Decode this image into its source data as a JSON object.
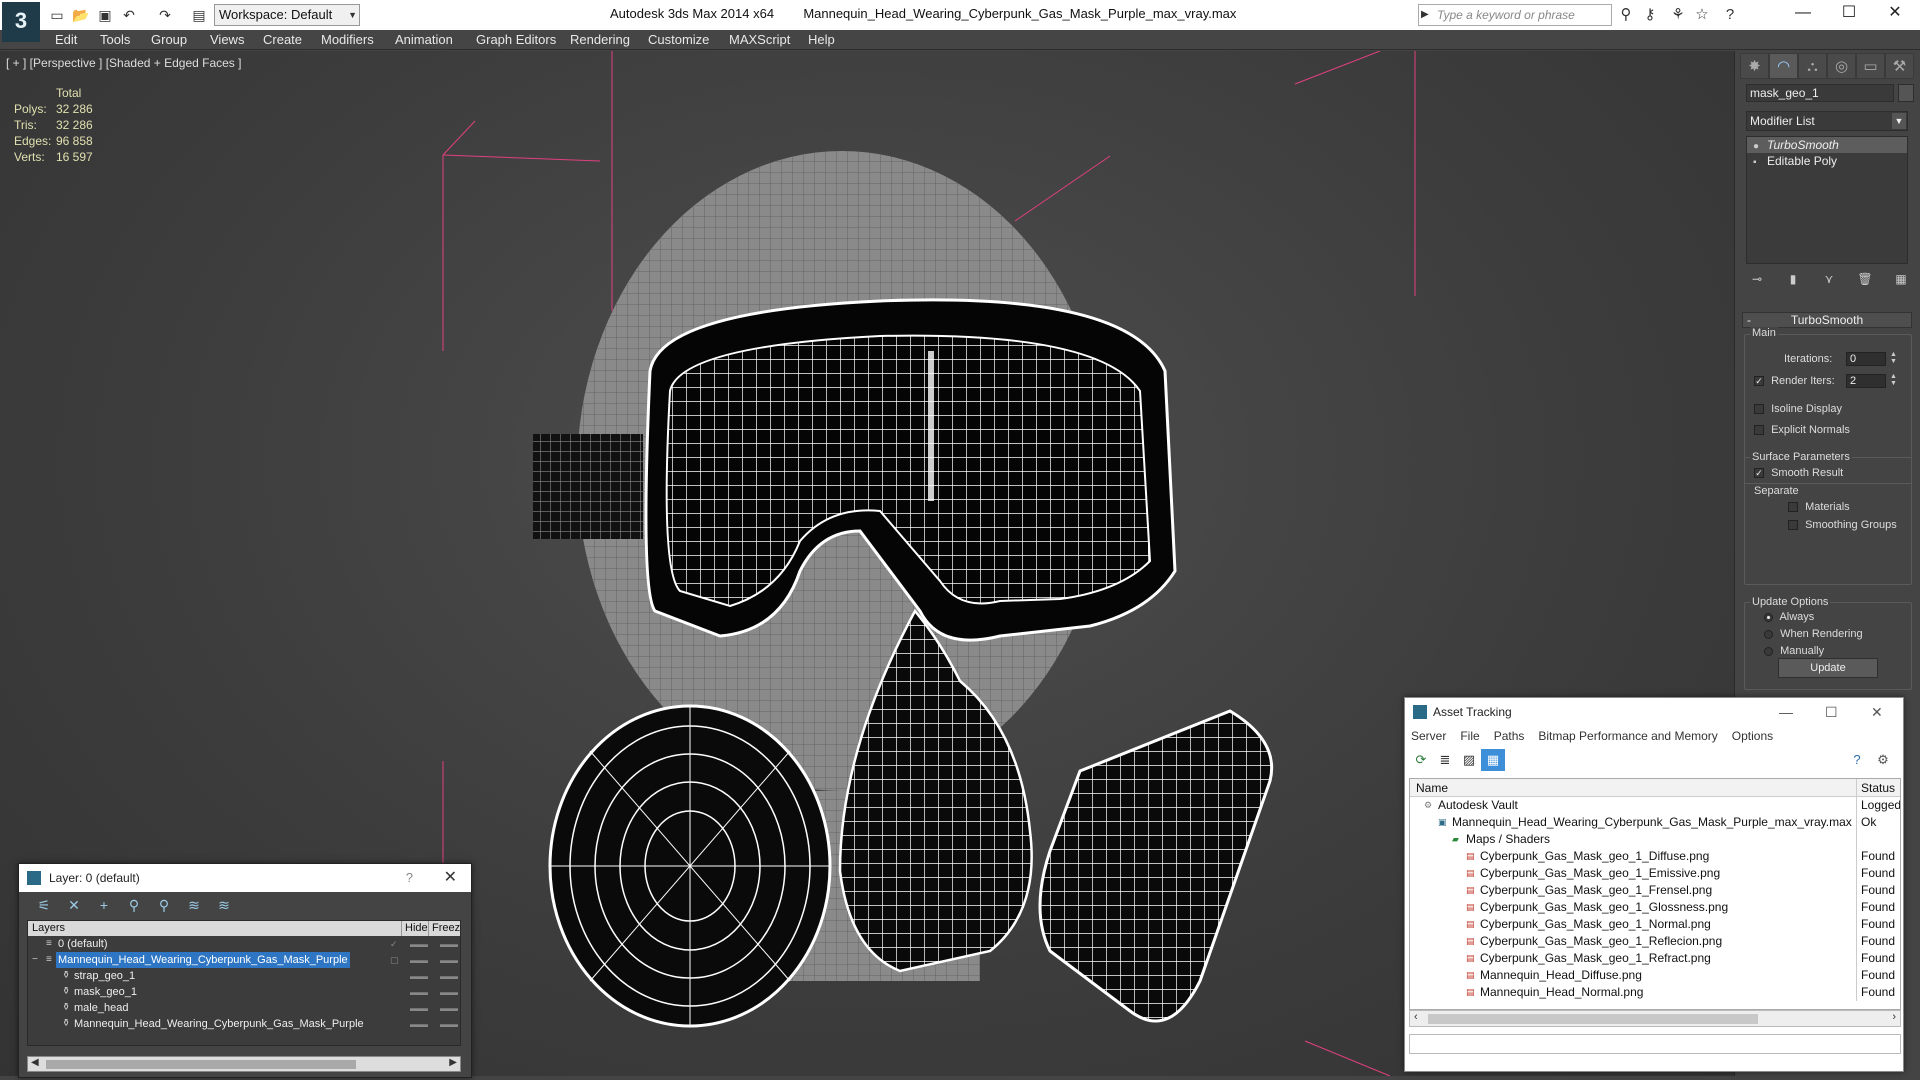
{
  "titlebar": {
    "workspace": "Workspace: Default",
    "app_name": "Autodesk 3ds Max  2014 x64",
    "file_name": "Mannequin_Head_Wearing_Cyberpunk_Gas_Mask_Purple_max_vray.max",
    "search_placeholder": "Type a keyword or phrase"
  },
  "menu": [
    "Edit",
    "Tools",
    "Group",
    "Views",
    "Create",
    "Modifiers",
    "Animation",
    "Graph Editors",
    "Rendering",
    "Customize",
    "MAXScript",
    "Help"
  ],
  "viewport": {
    "label": "[ + ] [Perspective ] [Shaded + Edged Faces ]",
    "stats": {
      "header": "Total",
      "rows": [
        {
          "key": "Polys:",
          "value": "32 286"
        },
        {
          "key": "Tris:",
          "value": "32 286"
        },
        {
          "key": "Edges:",
          "value": "96 858"
        },
        {
          "key": "Verts:",
          "value": "16 597"
        }
      ]
    }
  },
  "command_panel": {
    "object_name": "mask_geo_1",
    "modifier_list": "Modifier List",
    "stack": [
      "TurboSmooth",
      "Editable Poly"
    ],
    "rollout_title": "TurboSmooth",
    "main_label": "Main",
    "iterations_label": "Iterations:",
    "iterations_value": "0",
    "render_iters_label": "Render Iters:",
    "render_iters_value": "2",
    "isoline_display": "Isoline Display",
    "explicit_normals": "Explicit Normals",
    "surface_params": "Surface Parameters",
    "smooth_result": "Smooth Result",
    "separate": "Separate",
    "materials": "Materials",
    "smoothing_groups": "Smoothing Groups",
    "update_options": "Update Options",
    "always": "Always",
    "when_rendering": "When Rendering",
    "manually": "Manually",
    "update_button": "Update"
  },
  "layer_window": {
    "title": "Layer: 0 (default)",
    "help": "?",
    "columns": {
      "layers": "Layers",
      "hide": "Hide",
      "freeze": "Freeze"
    },
    "rows": [
      {
        "name": "0 (default)",
        "indent": 0
      },
      {
        "name": "Mannequin_Head_Wearing_Cyberpunk_Gas_Mask_Purple",
        "indent": 0
      },
      {
        "name": "strap_geo_1",
        "indent": 1
      },
      {
        "name": "mask_geo_1",
        "indent": 1
      },
      {
        "name": "male_head",
        "indent": 1
      },
      {
        "name": "Mannequin_Head_Wearing_Cyberpunk_Gas_Mask_Purple",
        "indent": 1
      }
    ]
  },
  "asset_window": {
    "title": "Asset Tracking",
    "menu": [
      "Server",
      "File",
      "Paths",
      "Bitmap Performance and Memory",
      "Options"
    ],
    "columns": {
      "name": "Name",
      "status": "Status"
    },
    "rows": [
      {
        "name": "Autodesk Vault",
        "status": "Logged",
        "indent": 0,
        "icon": "vault"
      },
      {
        "name": "Mannequin_Head_Wearing_Cyberpunk_Gas_Mask_Purple_max_vray.max",
        "status": "Ok",
        "indent": 1,
        "icon": "max"
      },
      {
        "name": "Maps / Shaders",
        "status": "",
        "indent": 2,
        "icon": "folder"
      },
      {
        "name": "Cyberpunk_Gas_Mask_geo_1_Diffuse.png",
        "status": "Found",
        "indent": 3,
        "icon": "png"
      },
      {
        "name": "Cyberpunk_Gas_Mask_geo_1_Emissive.png",
        "status": "Found",
        "indent": 3,
        "icon": "png"
      },
      {
        "name": "Cyberpunk_Gas_Mask_geo_1_Frensel.png",
        "status": "Found",
        "indent": 3,
        "icon": "png"
      },
      {
        "name": "Cyberpunk_Gas_Mask_geo_1_Glossness.png",
        "status": "Found",
        "indent": 3,
        "icon": "png"
      },
      {
        "name": "Cyberpunk_Gas_Mask_geo_1_Normal.png",
        "status": "Found",
        "indent": 3,
        "icon": "png"
      },
      {
        "name": "Cyberpunk_Gas_Mask_geo_1_Reflecion.png",
        "status": "Found",
        "indent": 3,
        "icon": "png"
      },
      {
        "name": "Cyberpunk_Gas_Mask_geo_1_Refract.png",
        "status": "Found",
        "indent": 3,
        "icon": "png"
      },
      {
        "name": "Mannequin_Head_Diffuse.png",
        "status": "Found",
        "indent": 3,
        "icon": "png"
      },
      {
        "name": "Mannequin_Head_Normal.png",
        "status": "Found",
        "indent": 3,
        "icon": "png"
      }
    ]
  },
  "icons": {
    "app_logo": "3ds-max-logo",
    "png_icon_color": "#c0392b",
    "selection_color": "#2e76c4",
    "stats_color": "#e0e0b0"
  }
}
